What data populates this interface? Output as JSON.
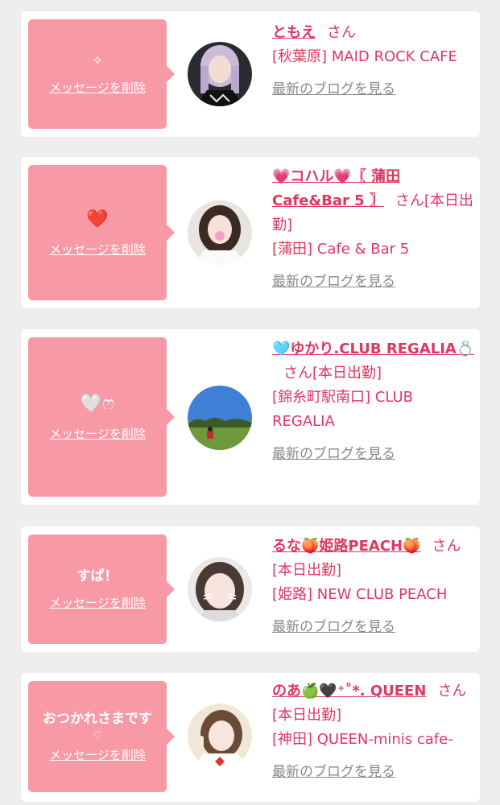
{
  "delete_label": "メッセージを削除",
  "blog_label": "最新のブログを見る",
  "san_label": "さん",
  "colors": {
    "bubble": "#f89aa6",
    "accent": "#e0365f",
    "link_gray": "#888888",
    "background": "#eeeeee"
  },
  "items": [
    {
      "message": "✧",
      "name": "ともえ",
      "suffix": "",
      "shop": "[秋葉原] MAID ROCK CAFE",
      "avatar_icon": "girl-portrait-dark"
    },
    {
      "message": "❤️",
      "name": "💗コハル💗〖 蒲田Cafe&Bar 5 〗",
      "suffix": "[本日出勤]",
      "shop": "[蒲田] Cafe & Bar 5",
      "avatar_icon": "girl-portrait-white"
    },
    {
      "message": "🤍ෆ",
      "name": "🩵ゆかり.CLUB REGALIA💍",
      "suffix": "[本日出勤]",
      "shop": "[錦糸町駅南口] CLUB REGALIA",
      "avatar_icon": "park-landscape"
    },
    {
      "message": "すぱ！",
      "name": "るな🍑姫路PEACH🍑",
      "suffix": "[本日出勤]",
      "shop": "[姫路] NEW CLUB PEACH",
      "avatar_icon": "girl-portrait-cat"
    },
    {
      "message": "おつかれさまです",
      "message_sub": "♡",
      "name": "のあ🍏🖤⁺˚*. QUEEN",
      "suffix": "[本日出勤]",
      "shop": "[神田] QUEEN-minis cafe-",
      "avatar_icon": "girl-portrait-peace"
    }
  ]
}
